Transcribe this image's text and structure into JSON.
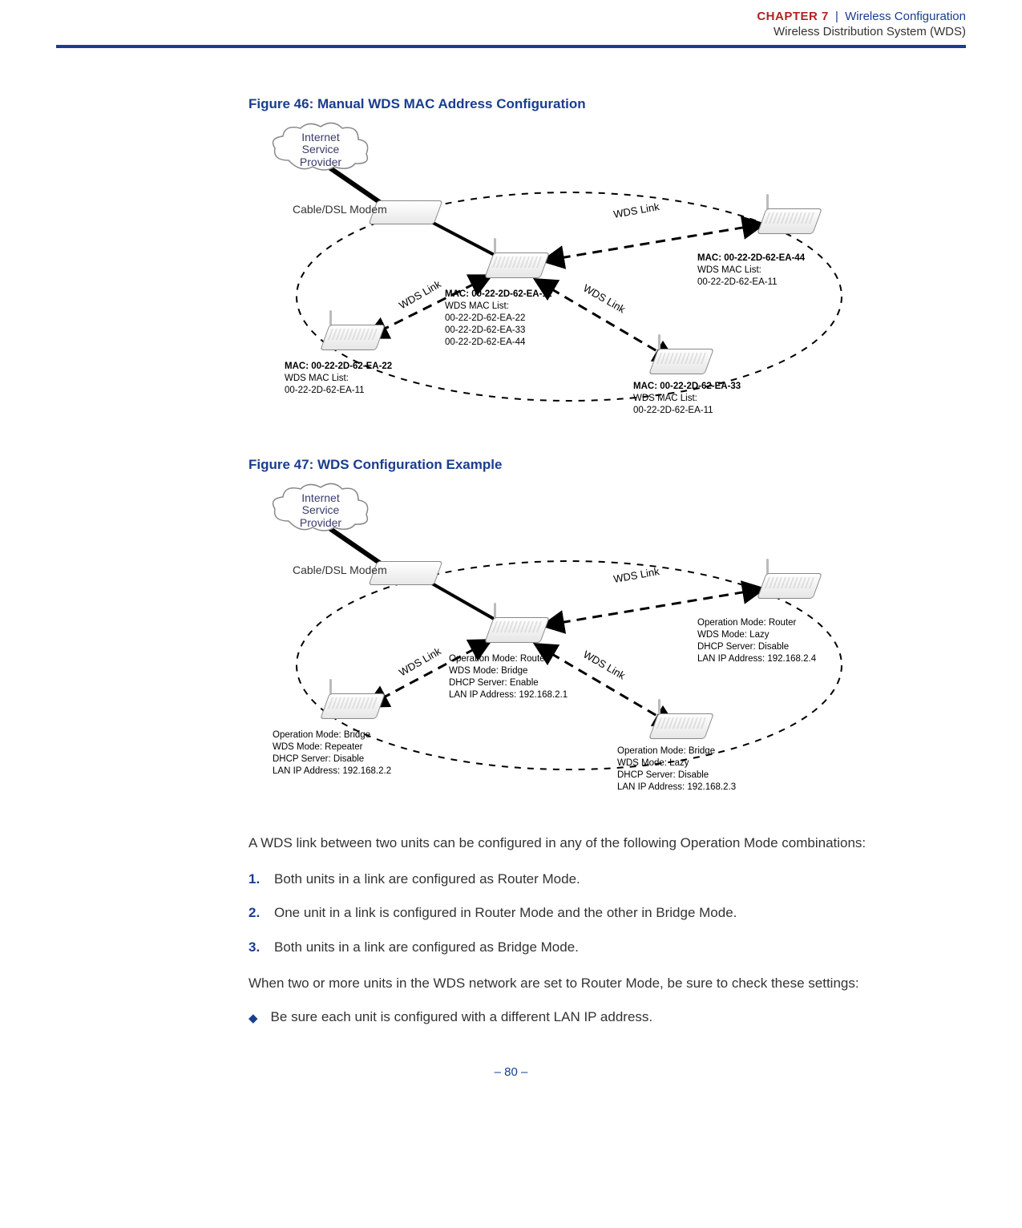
{
  "header": {
    "chapter_label": "CHAPTER 7",
    "chapter_topic": "Wireless Configuration",
    "sub_line": "Wireless Distribution System (WDS)"
  },
  "figure46": {
    "title": "Figure 46:  Manual WDS MAC Address Configuration",
    "isp": "Internet\nService\nProvider",
    "modem": "Cable/DSL\nModem",
    "wds_link": "WDS Link",
    "center": {
      "mac": "MAC: 00-22-2D-62-EA-11",
      "list_header": "WDS MAC List:",
      "list": [
        "00-22-2D-62-EA-22",
        "00-22-2D-62-EA-33",
        "00-22-2D-62-EA-44"
      ]
    },
    "left": {
      "mac": "MAC: 00-22-2D-62-EA-22",
      "list_header": "WDS MAC List:",
      "list": [
        "00-22-2D-62-EA-11"
      ]
    },
    "bottom": {
      "mac": "MAC: 00-22-2D-62-EA-33",
      "list_header": "WDS MAC List:",
      "list": [
        "00-22-2D-62-EA-11"
      ]
    },
    "right": {
      "mac": "MAC: 00-22-2D-62-EA-44",
      "list_header": "WDS MAC List:",
      "list": [
        "00-22-2D-62-EA-11"
      ]
    }
  },
  "figure47": {
    "title": "Figure 47:  WDS Configuration Example",
    "isp": "Internet\nService\nProvider",
    "modem": "Cable/DSL\nModem",
    "wds_link": "WDS Link",
    "center": [
      "Operation Mode: Router",
      "WDS Mode: Bridge",
      "DHCP Server: Enable",
      "LAN IP Address: 192.168.2.1"
    ],
    "left": [
      "Operation Mode: Bridge",
      "WDS Mode: Repeater",
      "DHCP Server: Disable",
      "LAN IP Address: 192.168.2.2"
    ],
    "bottom": [
      "Operation Mode: Bridge",
      "WDS Mode: Lazy",
      "DHCP Server: Disable",
      "LAN IP Address: 192.168.2.3"
    ],
    "right": [
      "Operation Mode: Router",
      "WDS Mode: Lazy",
      "DHCP Server: Disable",
      "LAN IP Address: 192.168.2.4"
    ]
  },
  "body": {
    "intro": "A WDS link between two units can be configured in any of the following Operation Mode combinations:",
    "items": [
      "Both units in a link are configured as Router Mode.",
      "One unit in a link is configured in Router Mode and the other in Bridge Mode.",
      "Both units in a link are configured as Bridge Mode."
    ],
    "note": "When two or more units in the WDS network are set to Router Mode, be sure to check these settings:",
    "bullets": [
      "Be sure each unit is configured with a different LAN IP address."
    ]
  },
  "page_number": "–  80  –"
}
